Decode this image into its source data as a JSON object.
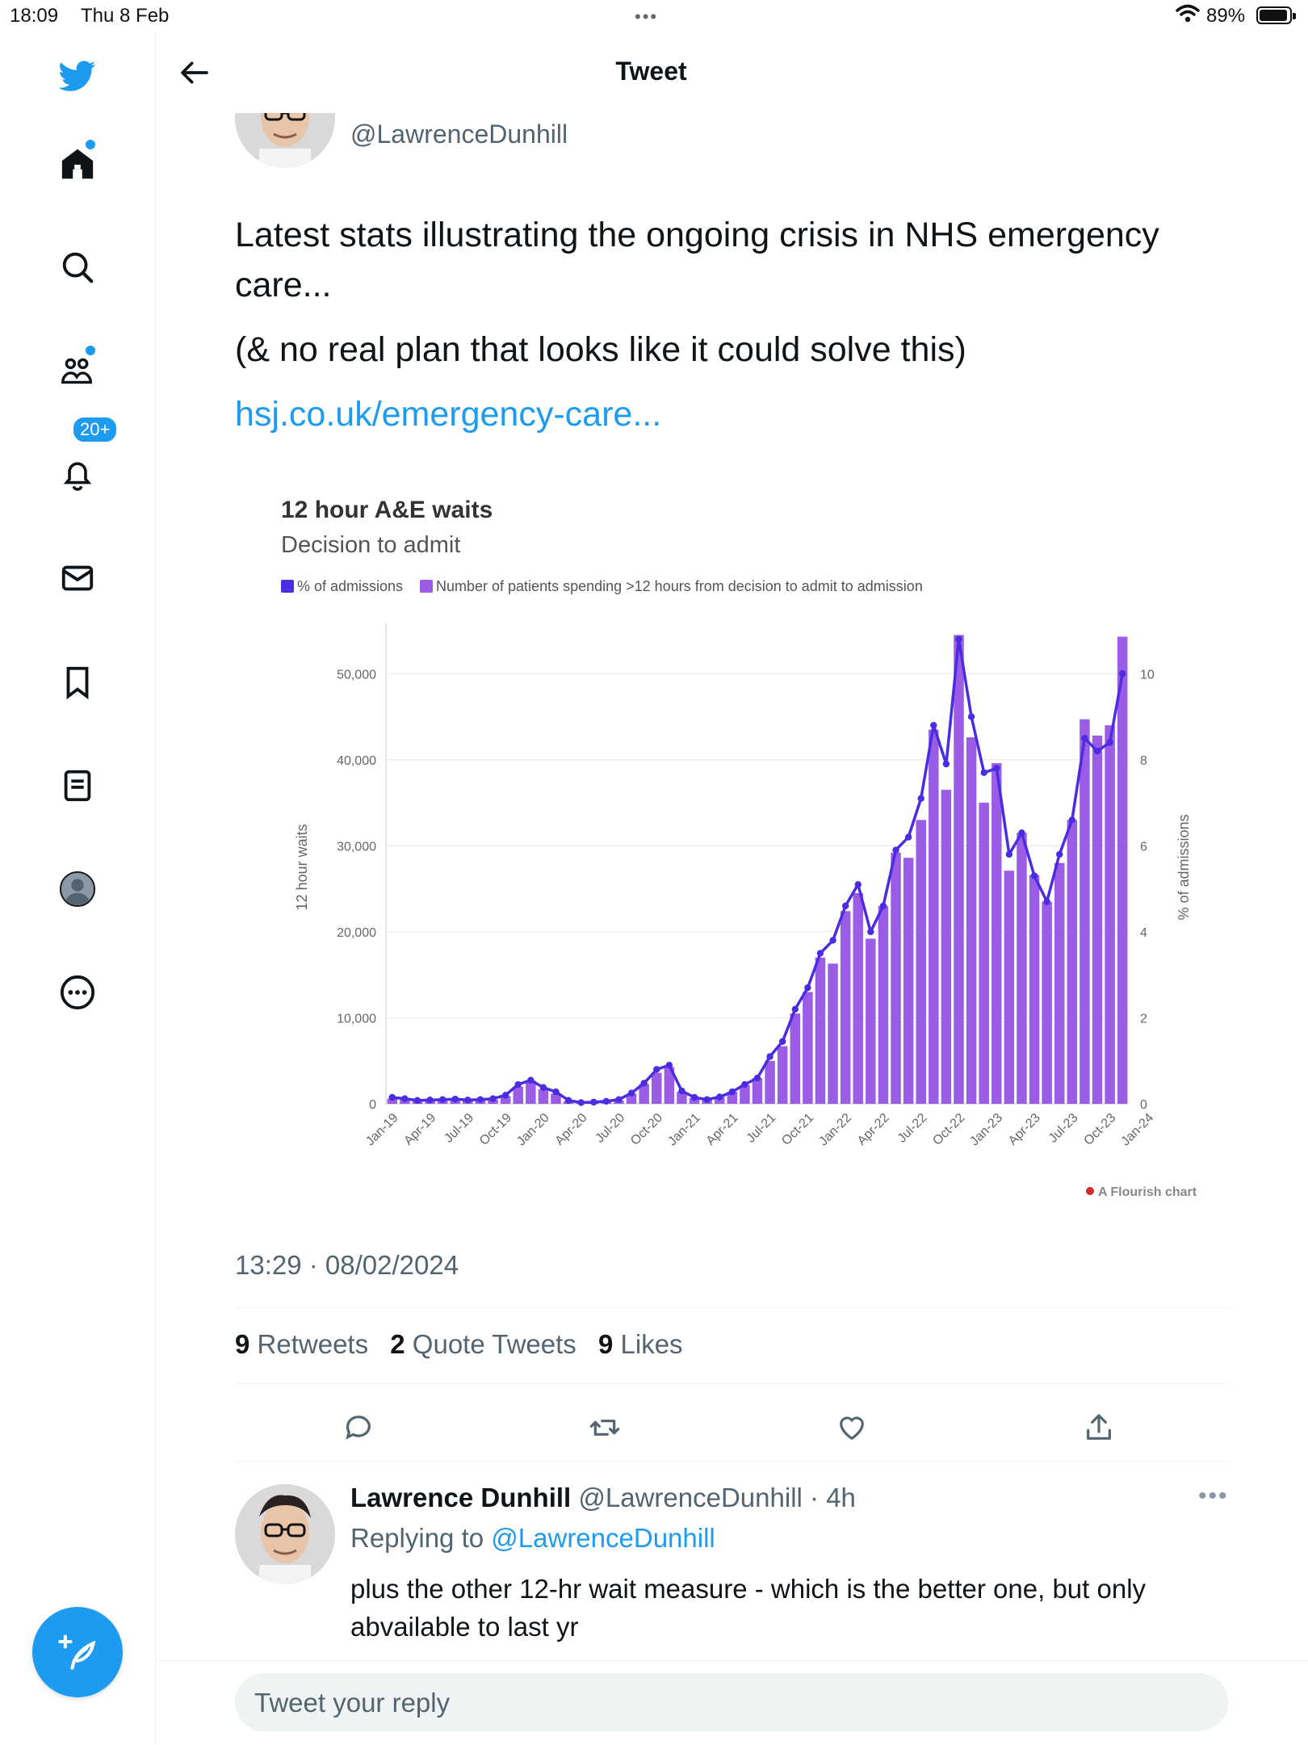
{
  "status_bar": {
    "time": "18:09",
    "date": "Thu 8 Feb",
    "battery": "89%"
  },
  "sidebar": {
    "notifications_badge": "20+"
  },
  "header": {
    "title": "Tweet"
  },
  "tweet": {
    "handle": "@LawrenceDunhill",
    "text_1": "Latest stats illustrating the ongoing crisis in NHS emergency care...",
    "text_2": "(& no real plan that looks like it could solve this)",
    "link": "hsj.co.uk/emergency-care...",
    "timestamp": "13:29 · 08/02/2024",
    "stats": {
      "retweets_count": "9",
      "retweets_label": "Retweets",
      "quotes_count": "2",
      "quotes_label": "Quote Tweets",
      "likes_count": "9",
      "likes_label": "Likes"
    }
  },
  "reply": {
    "name": "Lawrence Dunhill",
    "handle_time": "@LawrenceDunhill · 4h",
    "replying_prefix": "Replying to",
    "replying_handle": "@LawrenceDunhill",
    "text": "plus the other 12-hr wait measure - which is the better one, but only abvailable to last yr"
  },
  "composer": {
    "placeholder": "Tweet your reply"
  },
  "colors": {
    "accent": "#1d9bf0",
    "bar": "#9b5de5",
    "line": "#4a2de0"
  },
  "chart_data": {
    "type": "bar",
    "title": "12 hour A&E waits",
    "subtitle": "Decision to admit",
    "legend": [
      "% of admissions",
      "Number of patients spending >12 hours from decision to admit to admission"
    ],
    "ylabel": "12 hour waits",
    "y2label": "% of admissions",
    "ylim": [
      0,
      55000
    ],
    "y2lim": [
      0,
      11
    ],
    "yticks": [
      "0",
      "10,000",
      "20,000",
      "30,000",
      "40,000",
      "50,000"
    ],
    "y2ticks": [
      "0",
      "2",
      "4",
      "6",
      "8",
      "10"
    ],
    "xtick_labels": [
      "Jan-19",
      "Apr-19",
      "Jul-19",
      "Oct-19",
      "Jan-20",
      "Apr-20",
      "Jul-20",
      "Oct-20",
      "Jan-21",
      "Apr-21",
      "Jul-21",
      "Oct-21",
      "Jan-22",
      "Apr-22",
      "Jul-22",
      "Oct-22",
      "Jan-23",
      "Apr-23",
      "Jul-23",
      "Oct-23",
      "Jan-24"
    ],
    "series": [
      {
        "name": "Number of patients spending >12 hours from decision to admit to admission",
        "type": "bar",
        "values": [
          600,
          500,
          300,
          350,
          400,
          450,
          350,
          400,
          500,
          900,
          2000,
          2700,
          1700,
          1200,
          300,
          100,
          150,
          250,
          400,
          1200,
          2300,
          3600,
          4300,
          1400,
          700,
          500,
          800,
          1400,
          2200,
          3000,
          5000,
          6700,
          10500,
          13000,
          17000,
          16300,
          22400,
          24500,
          19200,
          23000,
          29200,
          28600,
          33000,
          43500,
          36500,
          54500,
          42600,
          35000,
          39600,
          27100,
          31500,
          26600,
          23500,
          28000,
          33000,
          44700,
          42800,
          44000,
          54300
        ]
      },
      {
        "name": "% of admissions",
        "type": "line",
        "values": [
          0.15,
          0.12,
          0.08,
          0.09,
          0.1,
          0.11,
          0.09,
          0.1,
          0.12,
          0.2,
          0.45,
          0.55,
          0.38,
          0.28,
          0.08,
          0.03,
          0.04,
          0.06,
          0.1,
          0.25,
          0.48,
          0.8,
          0.9,
          0.3,
          0.15,
          0.1,
          0.16,
          0.28,
          0.45,
          0.6,
          1.1,
          1.45,
          2.2,
          2.7,
          3.5,
          3.8,
          4.6,
          5.1,
          4.0,
          4.6,
          5.9,
          6.2,
          7.1,
          8.8,
          7.9,
          10.8,
          9.0,
          7.7,
          7.8,
          5.8,
          6.3,
          5.3,
          4.7,
          5.8,
          6.6,
          8.5,
          8.2,
          8.4,
          10.0
        ]
      }
    ],
    "credit": "A Flourish chart"
  }
}
